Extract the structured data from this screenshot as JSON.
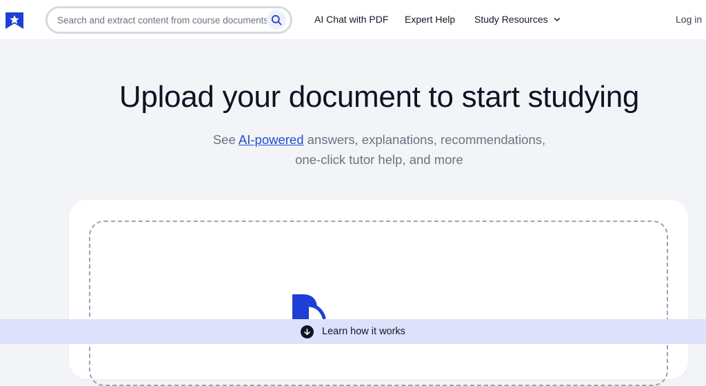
{
  "header": {
    "search": {
      "placeholder": "Search and extract content from course documents, study guides, and more"
    },
    "nav": {
      "ai_chat": "AI Chat with PDF",
      "expert_help": "Expert Help",
      "study_resources": "Study Resources",
      "login": "Log in"
    }
  },
  "hero": {
    "title": "Upload your document to start studying",
    "subtitle_prefix": "See ",
    "subtitle_link": "AI-powered",
    "subtitle_suffix": " answers, explanations, recommendations,",
    "subtitle_line2": "one-click tutor help, and more"
  },
  "bottom_bar": {
    "label": "Learn how it works"
  },
  "colors": {
    "brand": "#1d3fd6",
    "accent": "#1d4ed8",
    "bar": "#dde1fb"
  },
  "icons": {
    "logo": "star-shield-logo-icon",
    "search": "search-icon",
    "dropdown": "chevron-down-icon",
    "document": "document-icon",
    "learn": "arrow-down-circle-icon"
  }
}
